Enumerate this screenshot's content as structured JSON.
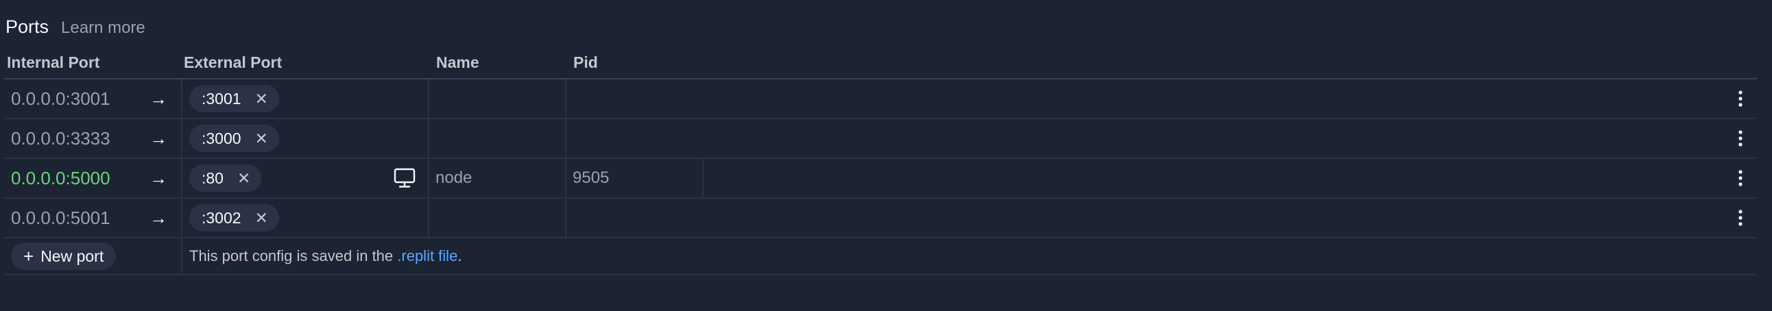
{
  "header": {
    "title": "Ports",
    "learn_more": "Learn more"
  },
  "columns": {
    "internal": "Internal Port",
    "external": "External Port",
    "name": "Name",
    "pid": "Pid"
  },
  "rows": [
    {
      "internal": "0.0.0.0:3001",
      "external": ":3001",
      "name": "",
      "pid": "",
      "active": false
    },
    {
      "internal": "0.0.0.0:3333",
      "external": ":3000",
      "name": "",
      "pid": "",
      "active": false
    },
    {
      "internal": "0.0.0.0:5000",
      "external": ":80",
      "name": "node",
      "pid": "9505",
      "active": true
    },
    {
      "internal": "0.0.0.0:5001",
      "external": ":3002",
      "name": "",
      "pid": "",
      "active": false
    }
  ],
  "glyphs": {
    "arrow": "→",
    "close": "✕",
    "plus": "+"
  },
  "footer": {
    "new_port_label": "New port",
    "note_prefix": "This port config is saved in the ",
    "note_link": ".replit file",
    "note_suffix": "."
  },
  "colors": {
    "background": "#1c2333",
    "chip": "#2b3245",
    "active_port": "#6cd37c",
    "link": "#57abff"
  },
  "icons": {
    "arrow": "arrow-right-icon",
    "close": "close-icon",
    "monitor": "monitor-icon",
    "kebab": "more-vertical-icon",
    "plus": "plus-icon"
  }
}
